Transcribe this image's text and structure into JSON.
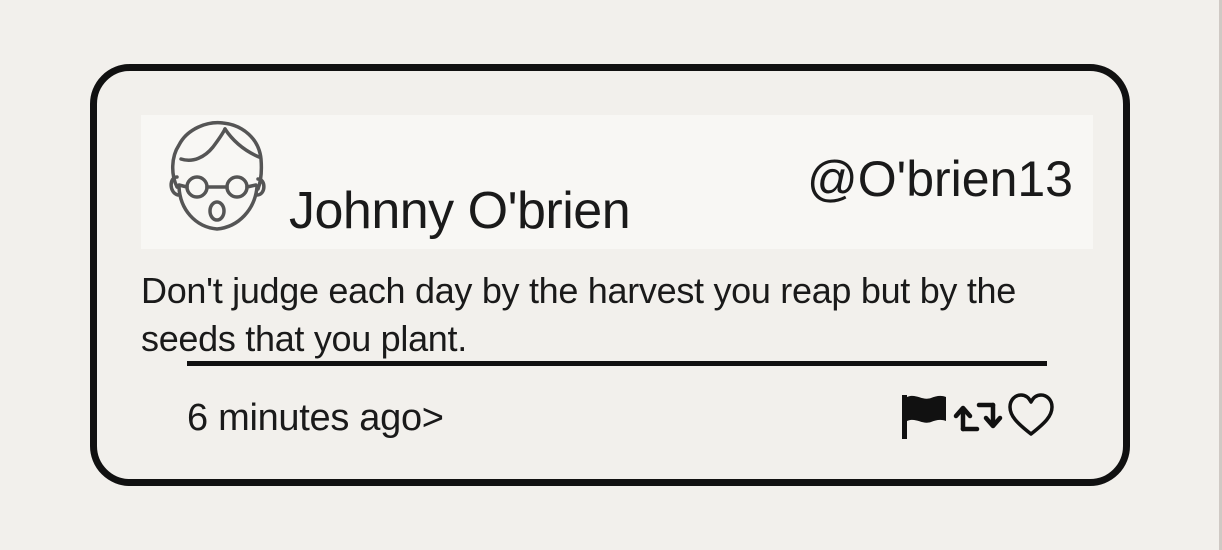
{
  "tweet": {
    "display_name": "Johnny O'brien",
    "handle": "@O'brien13",
    "text": "Don't judge each day by the harvest you reap but by the seeds that you plant.",
    "timestamp": "6 minutes ago>",
    "avatar_icon": "user-avatar-icon",
    "actions": [
      {
        "icon": "flag-icon"
      },
      {
        "icon": "retweet-icon"
      },
      {
        "icon": "heart-icon"
      }
    ]
  },
  "colors": {
    "background": "#f2f0ec",
    "card_border": "#111111",
    "header_band": "#f8f7f4",
    "text": "#1a1a1a"
  }
}
